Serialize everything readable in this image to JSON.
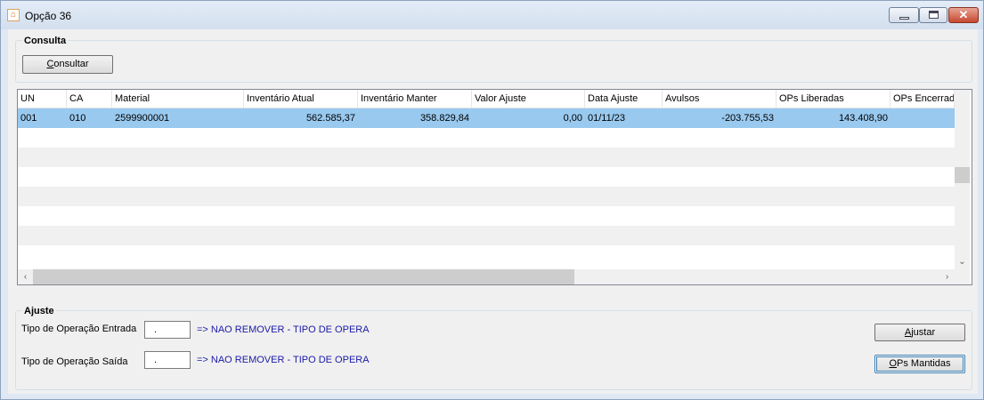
{
  "window": {
    "title": "Opção 36",
    "icon": "app-icon",
    "controls": [
      "minimize-icon",
      "maximize-icon",
      "close-icon"
    ]
  },
  "consulta": {
    "label": "Consulta",
    "button_label": "Consultar",
    "button_mnemonic": "C",
    "button_rest": "onsultar"
  },
  "grid": {
    "columns": [
      "UN",
      "CA",
      "Material",
      "Inventário Atual",
      "Inventário Manter",
      "Valor Ajuste",
      "Data Ajuste",
      "Avulsos",
      "OPs Liberadas",
      "OPs Encerrad"
    ],
    "rows": [
      {
        "selected": true,
        "cells": [
          "001",
          "010",
          "2599900001",
          "562.585,37",
          "358.829,84",
          "0,00",
          "01/11/23",
          "-203.755,53",
          "143.408,90",
          ""
        ]
      }
    ],
    "selection_color": "#99c9ef"
  },
  "ajuste": {
    "label": "Ajuste",
    "entrada_label": "Tipo de Operação Entrada",
    "entrada_value": ".",
    "entrada_hint": "=> NAO REMOVER - TIPO DE OPERACAO",
    "saida_label": "Tipo de Operação Saída",
    "saida_value": ".",
    "saida_hint": "=> NAO REMOVER - TIPO DE OPERACAO",
    "ajustar_mnemonic": "A",
    "ajustar_rest": "justar",
    "ops_mnemonic": "O",
    "ops_rest": "Ps Mantidas"
  }
}
